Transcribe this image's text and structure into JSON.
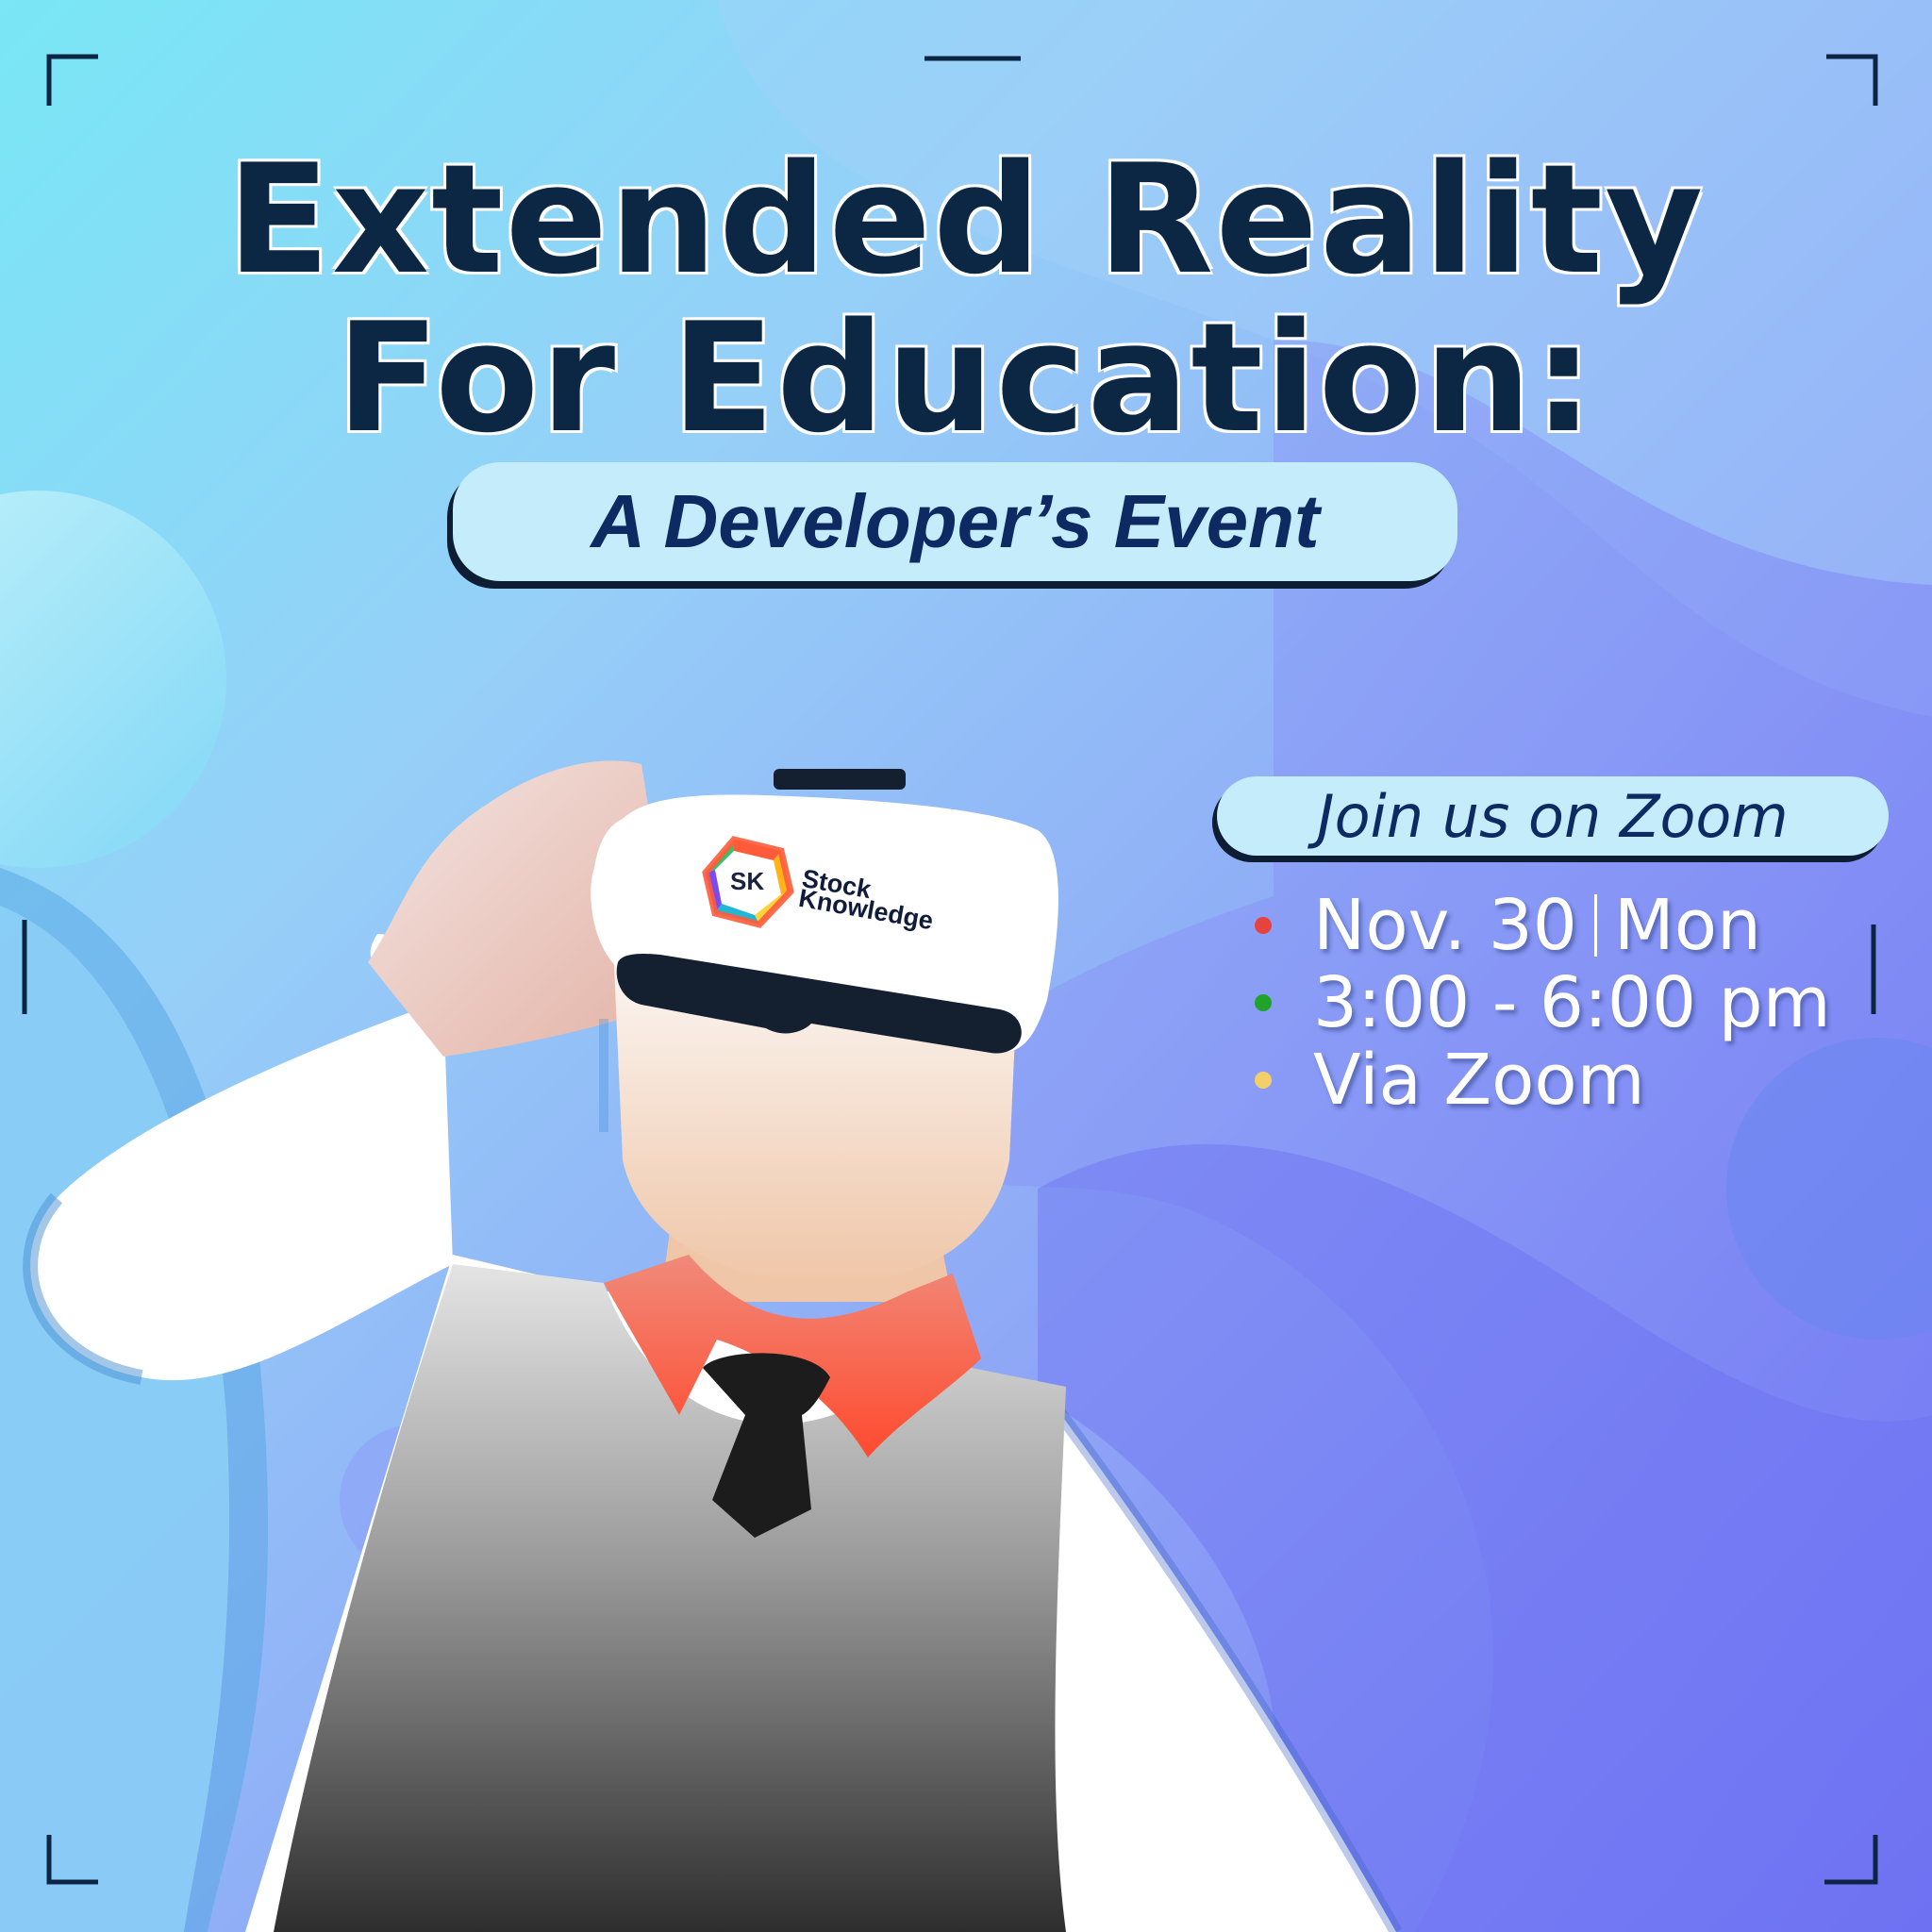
{
  "headline": {
    "line1": "Extended Reality",
    "line2": "For Education:"
  },
  "subtitle": "A Developer’s Event",
  "zoom_banner": "Join us on Zoom",
  "details": {
    "date": "Nov. 30",
    "day": "Mon",
    "time": "3:00 - 6:00 pm",
    "venue": "Via Zoom"
  },
  "logo": {
    "initials": "SK",
    "name_line1": "Stock",
    "name_line2": "Knowledge"
  },
  "colors": {
    "title": "#0b2744",
    "pill_bg": "#c5ecfb",
    "dot_date": "#e8423e",
    "dot_time": "#1fa32b",
    "dot_venue": "#f3cf6a"
  },
  "icons": [
    "frame-corner-icon",
    "bullet-dot-icon",
    "vr-headset-icon",
    "hexagon-logo-icon"
  ]
}
